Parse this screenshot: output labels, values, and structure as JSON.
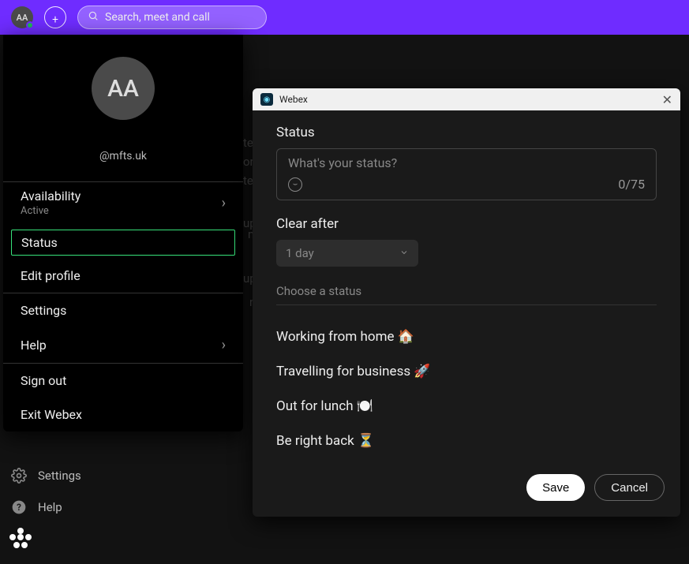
{
  "header": {
    "avatar_initials": "AA",
    "search_placeholder": "Search, meet and call"
  },
  "profile": {
    "avatar_initials": "AA",
    "username": "@mfts.uk",
    "menu": {
      "availability_label": "Availability",
      "availability_value": "Active",
      "status_label": "Status",
      "edit_profile_label": "Edit profile",
      "settings_label": "Settings",
      "help_label": "Help",
      "sign_out_label": "Sign out",
      "exit_label": "Exit Webex"
    }
  },
  "bottom_left": {
    "settings_label": "Settings",
    "help_label": "Help"
  },
  "dialog": {
    "app_name": "Webex",
    "status_heading": "Status",
    "status_placeholder": "What's your status?",
    "char_count": "0/75",
    "clear_after_label": "Clear after",
    "clear_after_value": "1 day",
    "choose_label": "Choose a status",
    "options": [
      {
        "label": "Working from home ",
        "emoji": "🏠"
      },
      {
        "label": "Travelling for business ",
        "emoji": "🚀"
      },
      {
        "label": "Out for lunch ",
        "emoji": "🍽️"
      },
      {
        "label": "Be right back ",
        "emoji": "⏳"
      }
    ],
    "save_label": "Save",
    "cancel_label": "Cancel"
  },
  "bg_fragments": [
    "te",
    "or",
    "te",
    "up",
    "m",
    "up",
    "n"
  ]
}
